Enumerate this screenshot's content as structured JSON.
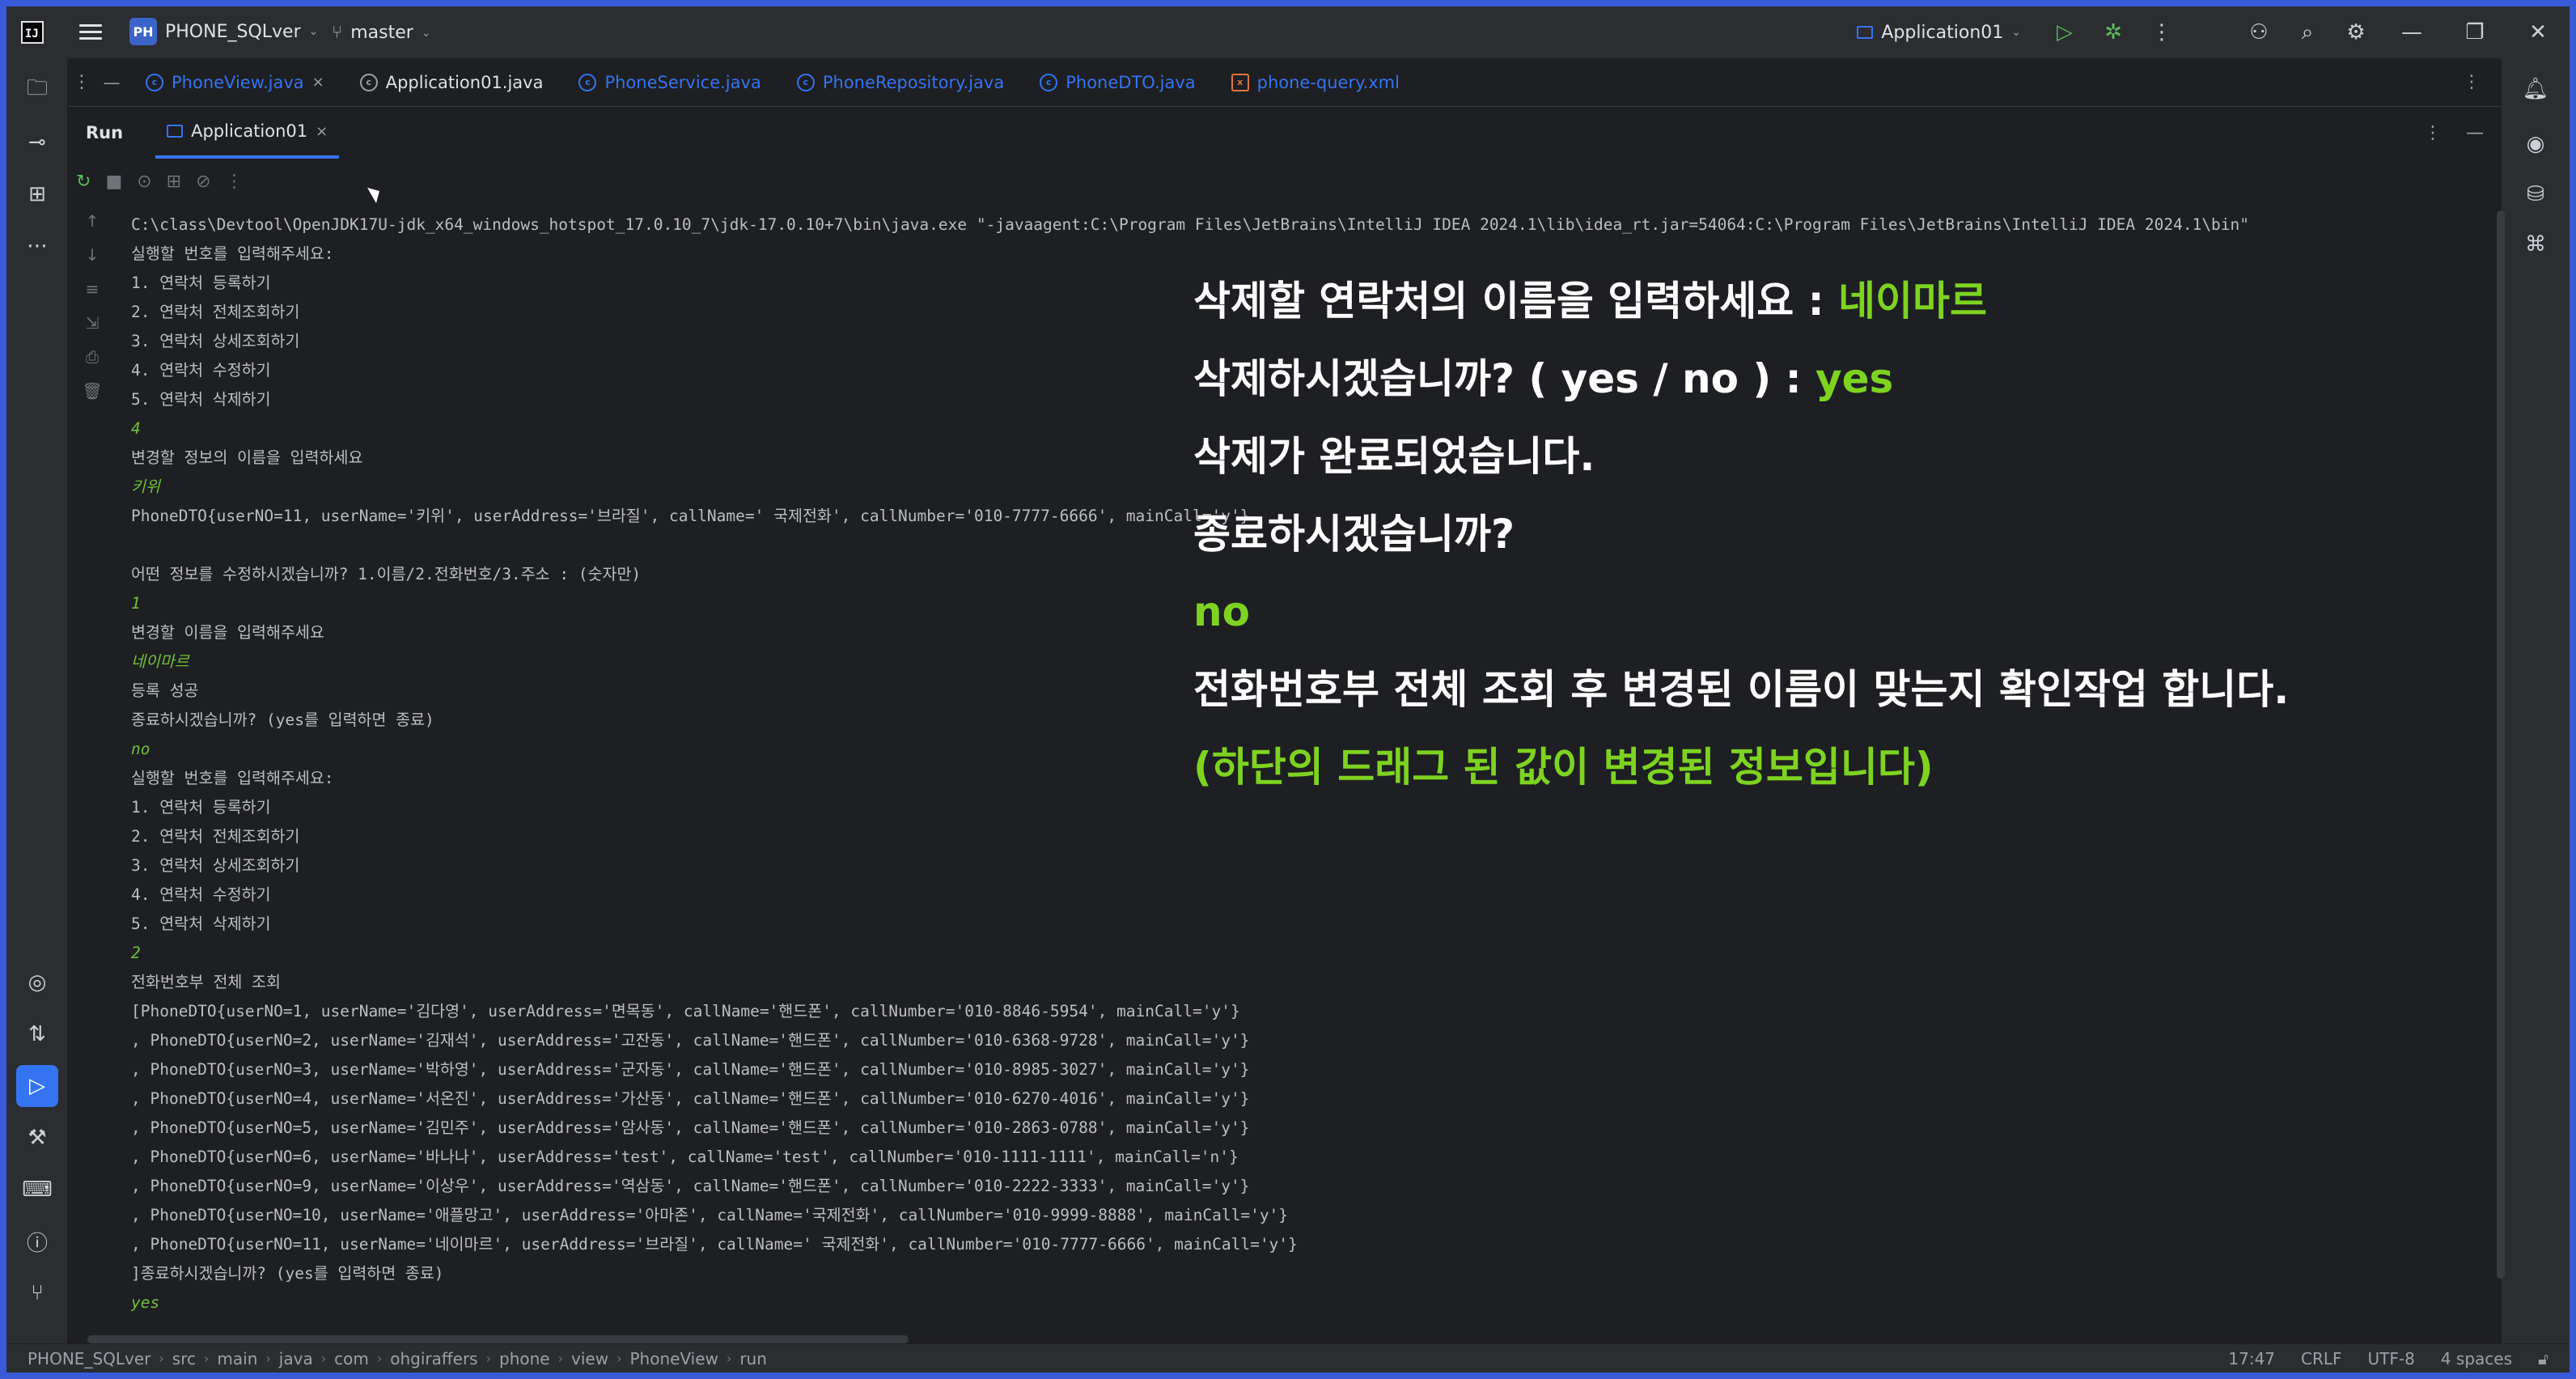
{
  "titlebar": {
    "project_badge": "PH",
    "project_name": "PHONE_SQLver",
    "branch": "master",
    "run_config": "Application01"
  },
  "editor_tabs": [
    {
      "label": "PhoneView.java",
      "icon": "java-class-icon",
      "active": true
    },
    {
      "label": "Application01.java",
      "icon": "java-app-icon",
      "active": false
    },
    {
      "label": "PhoneService.java",
      "icon": "java-class-icon",
      "active": false
    },
    {
      "label": "PhoneRepository.java",
      "icon": "java-class-icon",
      "active": false
    },
    {
      "label": "PhoneDTO.java",
      "icon": "java-class-icon",
      "active": false
    },
    {
      "label": "phone-query.xml",
      "icon": "xml-file-icon",
      "active": false
    }
  ],
  "run_panel": {
    "title": "Run",
    "tab_label": "Application01"
  },
  "console": {
    "lines": [
      {
        "text": "C:\\class\\Devtool\\OpenJDK17U-jdk_x64_windows_hotspot_17.0.10_7\\jdk-17.0.10+7\\bin\\java.exe \"-javaagent:C:\\Program Files\\JetBrains\\IntelliJ IDEA 2024.1\\lib\\idea_rt.jar=54064:C:\\Program Files\\JetBrains\\IntelliJ IDEA 2024.1\\bin\"",
        "type": "out"
      },
      {
        "text": "실행할 번호를 입력해주세요:",
        "type": "out"
      },
      {
        "text": "1. 연락처 등록하기",
        "type": "out"
      },
      {
        "text": "2. 연락처 전체조회하기",
        "type": "out"
      },
      {
        "text": "3. 연락처 상세조회하기",
        "type": "out"
      },
      {
        "text": "4. 연락처 수정하기",
        "type": "out"
      },
      {
        "text": "5. 연락처 삭제하기",
        "type": "out"
      },
      {
        "text": "4",
        "type": "input"
      },
      {
        "text": "변경할 정보의 이름을 입력하세요",
        "type": "out"
      },
      {
        "text": "키위",
        "type": "input"
      },
      {
        "text": "PhoneDTO{userNO=11, userName='키위', userAddress='브라질', callName=' 국제전화', callNumber='010-7777-6666', mainCall='y'}",
        "type": "out"
      },
      {
        "text": "",
        "type": "out"
      },
      {
        "text": "어떤 정보를 수정하시겠습니까? 1.이름/2.전화번호/3.주소 : (숫자만)",
        "type": "out"
      },
      {
        "text": "1",
        "type": "input"
      },
      {
        "text": "변경할 이름을 입력해주세요",
        "type": "out"
      },
      {
        "text": "네이마르",
        "type": "input"
      },
      {
        "text": "등록 성공",
        "type": "out"
      },
      {
        "text": "종료하시겠습니까? (yes를 입력하면 종료)",
        "type": "out"
      },
      {
        "text": "no",
        "type": "input"
      },
      {
        "text": "실행할 번호를 입력해주세요:",
        "type": "out"
      },
      {
        "text": "1. 연락처 등록하기",
        "type": "out"
      },
      {
        "text": "2. 연락처 전체조회하기",
        "type": "out"
      },
      {
        "text": "3. 연락처 상세조회하기",
        "type": "out"
      },
      {
        "text": "4. 연락처 수정하기",
        "type": "out"
      },
      {
        "text": "5. 연락처 삭제하기",
        "type": "out"
      },
      {
        "text": "2",
        "type": "input"
      },
      {
        "text": "전화번호부 전체 조회",
        "type": "out"
      },
      {
        "text": "[PhoneDTO{userNO=1, userName='김다영', userAddress='면목동', callName='핸드폰', callNumber='010-8846-5954', mainCall='y'}",
        "type": "out"
      },
      {
        "text": ", PhoneDTO{userNO=2, userName='김재석', userAddress='고잔동', callName='핸드폰', callNumber='010-6368-9728', mainCall='y'}",
        "type": "out"
      },
      {
        "text": ", PhoneDTO{userNO=3, userName='박하영', userAddress='군자동', callName='핸드폰', callNumber='010-8985-3027', mainCall='y'}",
        "type": "out"
      },
      {
        "text": ", PhoneDTO{userNO=4, userName='서온진', userAddress='가산동', callName='핸드폰', callNumber='010-6270-4016', mainCall='y'}",
        "type": "out"
      },
      {
        "text": ", PhoneDTO{userNO=5, userName='김민주', userAddress='암사동', callName='핸드폰', callNumber='010-2863-0788', mainCall='y'}",
        "type": "out"
      },
      {
        "text": ", PhoneDTO{userNO=6, userName='바나나', userAddress='test', callName='test', callNumber='010-1111-1111', mainCall='n'}",
        "type": "out"
      },
      {
        "text": ", PhoneDTO{userNO=9, userName='이상우', userAddress='역삼동', callName='핸드폰', callNumber='010-2222-3333', mainCall='y'}",
        "type": "out"
      },
      {
        "text": ", PhoneDTO{userNO=10, userName='애플망고', userAddress='아마존', callName='국제전화', callNumber='010-9999-8888', mainCall='y'}",
        "type": "out"
      },
      {
        "text": ", PhoneDTO{userNO=11, userName='네이마르', userAddress='브라질', callName=' 국제전화', callNumber='010-7777-6666', mainCall='y'}",
        "type": "out"
      },
      {
        "text": "]종료하시겠습니까? (yes를 입력하면 종료)",
        "type": "out"
      },
      {
        "text": "yes",
        "type": "input"
      }
    ]
  },
  "overlay": {
    "lines": [
      {
        "prefix": "삭제할 연락처의 이름을 입력하세요 : ",
        "highlight": "네이마르"
      },
      {
        "prefix": "삭제하시겠습니까? ( yes / no ) : ",
        "highlight": "yes"
      },
      {
        "prefix": "삭제가 완료되었습니다.",
        "highlight": ""
      },
      {
        "prefix": "종료하시겠습니까?",
        "highlight": ""
      },
      {
        "prefix": "",
        "highlight": "no"
      },
      {
        "prefix": "전화번호부 전체 조회 후 변경된 이름이 맞는지 확인작업 합니다.",
        "highlight": ""
      },
      {
        "prefix": "",
        "highlight": "(하단의 드래그 된 값이 변경된 정보입니다)"
      }
    ]
  },
  "statusbar": {
    "breadcrumbs": [
      "PHONE_SQLver",
      "src",
      "main",
      "java",
      "com",
      "ohgiraffers",
      "phone",
      "view",
      "PhoneView",
      "run"
    ],
    "position": "17:47",
    "line_sep": "CRLF",
    "encoding": "UTF-8",
    "indent": "4 spaces"
  },
  "colors": {
    "accent": "#3574f0",
    "input_green": "#6fbf3a",
    "overlay_green": "#7ed321",
    "background": "#1e1f22",
    "panel": "#2b2d30"
  }
}
